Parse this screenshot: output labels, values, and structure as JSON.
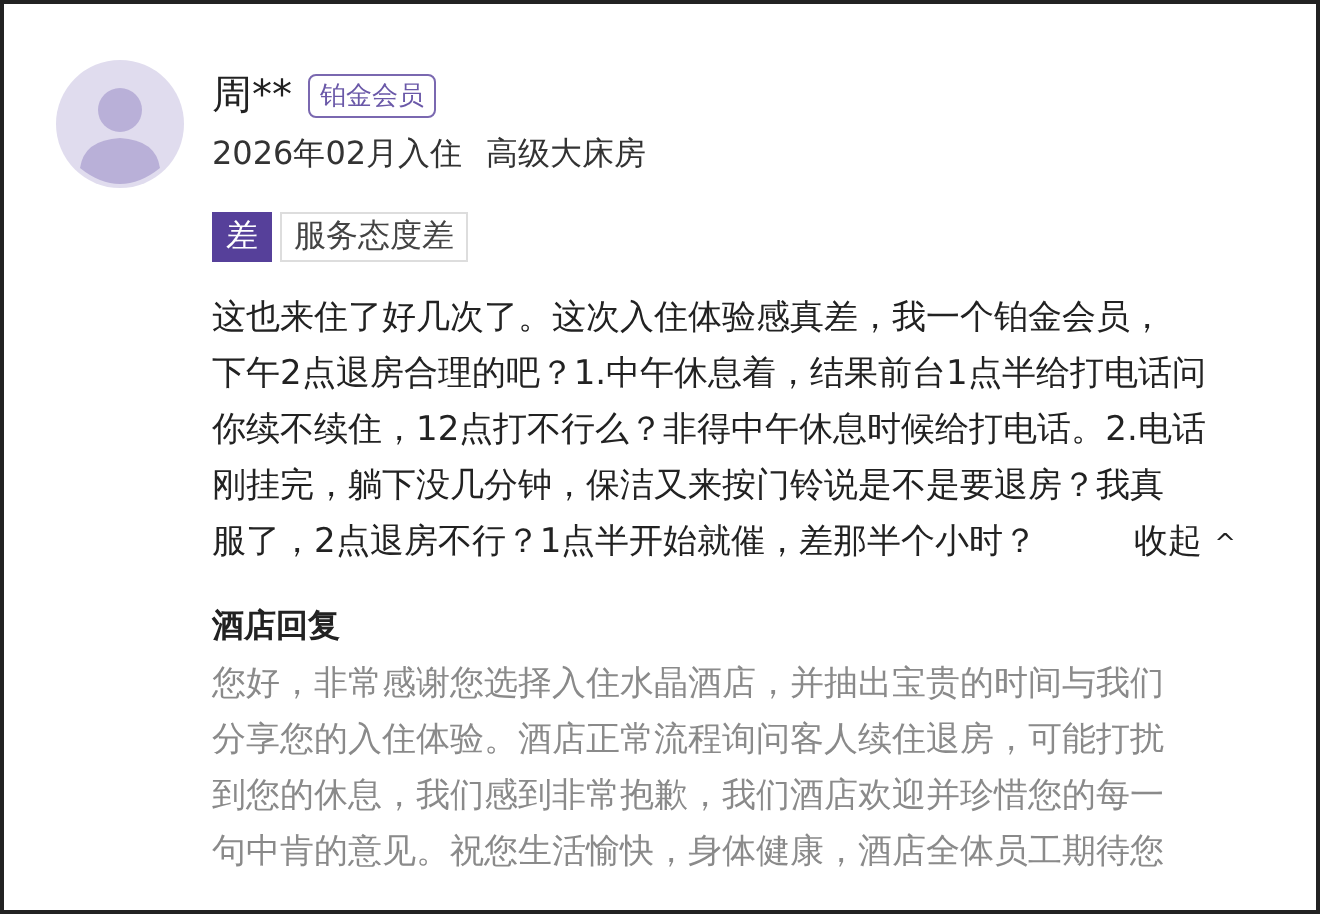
{
  "review": {
    "user": {
      "name": "周**",
      "badge": "铂金会员"
    },
    "stay": "2026年02月入住",
    "room": "高级大床房",
    "rating_tag": "差",
    "tags": [
      "服务态度差"
    ],
    "lines": [
      "这也来住了好几次了。这次入住体验感真差，我一个铂金会员，",
      "下午2点退房合理的吧？1.中午休息着，结果前台1点半给打电话问",
      "你续不续住，12点打不行么？非得中午休息时候给打电话。2.电话",
      "刚挂完，躺下没几分钟，保洁又来按门铃说是不是要退房？我真",
      "服了，2点退房不行？1点半开始就催，差那半个小时？"
    ],
    "collapse": "收起",
    "collapse_icon": "^"
  },
  "hotel_reply": {
    "title": "酒店回复",
    "lines": [
      "您好，非常感谢您选择入住水晶酒店，并抽出宝贵的时间与我们",
      "分享您的入住体验。酒店正常流程询问客人续住退房，可能打扰",
      "到您的休息，我们感到非常抱歉，我们酒店欢迎并珍惜您的每一",
      "句中肯的意见。祝您生活愉快，身体健康，酒店全体员工期待您"
    ]
  }
}
